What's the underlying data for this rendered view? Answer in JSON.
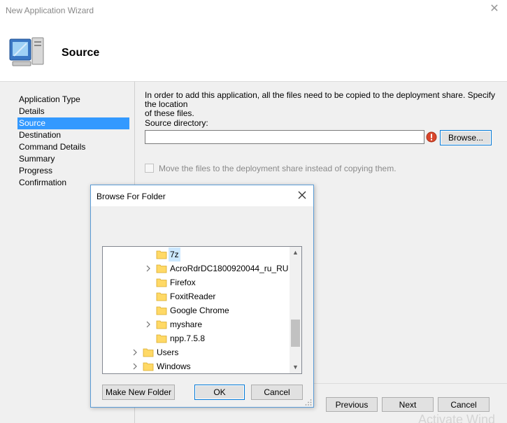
{
  "window": {
    "title": "New Application Wizard"
  },
  "header": {
    "title": "Source"
  },
  "sidebar": {
    "items": [
      {
        "label": "Application Type"
      },
      {
        "label": "Details"
      },
      {
        "label": "Source",
        "active": true
      },
      {
        "label": "Destination"
      },
      {
        "label": "Command Details"
      },
      {
        "label": "Summary"
      },
      {
        "label": "Progress"
      },
      {
        "label": "Confirmation"
      }
    ]
  },
  "content": {
    "intro_line1": "In order to add this application, all the files need to be copied to the deployment share.  Specify the location",
    "intro_line2": "of these files.",
    "source_label": "Source directory:",
    "source_value": "",
    "browse_label": "Browse...",
    "move_label": "Move the files to the deployment share instead of copying them.",
    "move_checked": false
  },
  "footer": {
    "previous_label": "Previous",
    "next_label": "Next",
    "cancel_label": "Cancel",
    "watermark": "Activate Wind"
  },
  "dialog": {
    "title": "Browse For Folder",
    "tree": [
      {
        "name": "7z",
        "selected": true,
        "expandable": false
      },
      {
        "name": "AcroRdrDC1800920044_ru_RU",
        "expandable": true
      },
      {
        "name": "Firefox",
        "expandable": false
      },
      {
        "name": "FoxitReader",
        "expandable": false
      },
      {
        "name": "Google Chrome",
        "expandable": false
      },
      {
        "name": "myshare",
        "expandable": true
      },
      {
        "name": "npp.7.5.8",
        "expandable": false
      },
      {
        "name": "Users",
        "expandable": true
      },
      {
        "name": "Windows",
        "expandable": true
      }
    ],
    "make_folder_label": "Make New Folder",
    "ok_label": "OK",
    "cancel_label": "Cancel"
  },
  "colors": {
    "accent": "#0078d7",
    "selection": "#3399ff",
    "folder": "#ffd966"
  }
}
